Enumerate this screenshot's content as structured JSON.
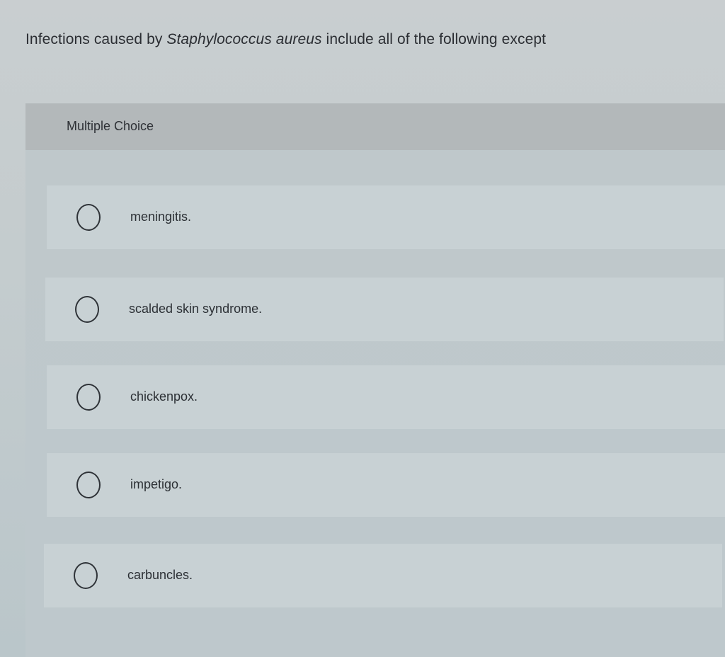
{
  "question": {
    "prefix": "Infections caused by ",
    "organism": "Staphylococcus aureus",
    "suffix": " include all of the following except"
  },
  "multiple_choice": {
    "header": "Multiple Choice",
    "options": [
      {
        "label": "meningitis."
      },
      {
        "label": "scalded skin syndrome."
      },
      {
        "label": "chickenpox."
      },
      {
        "label": "impetigo."
      },
      {
        "label": "carbuncles."
      }
    ]
  }
}
